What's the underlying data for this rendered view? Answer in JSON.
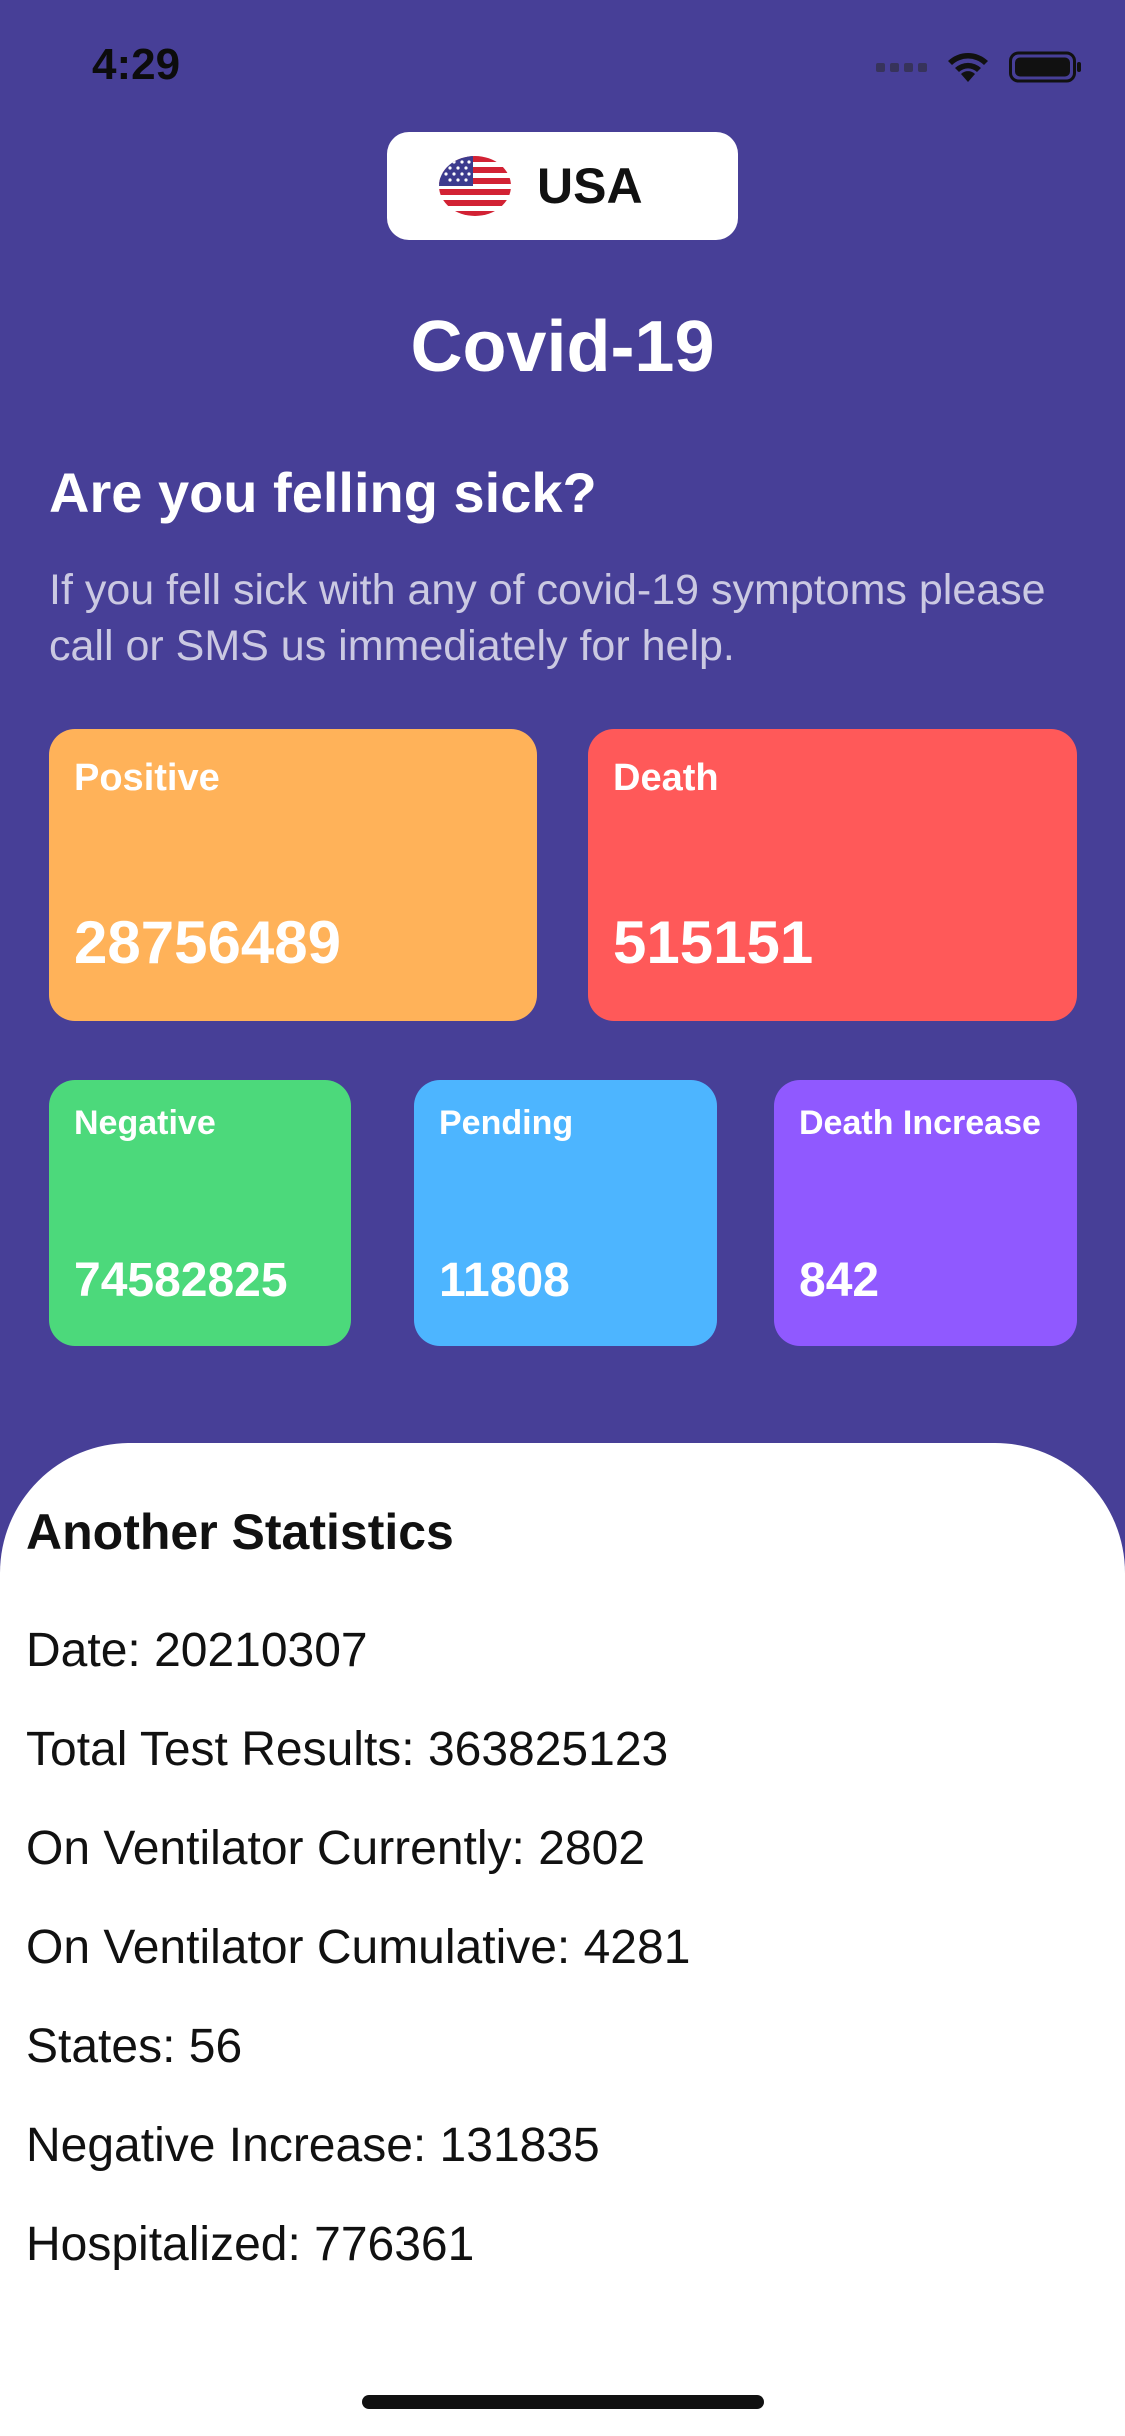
{
  "status_bar": {
    "time": "4:29"
  },
  "country": {
    "name": "USA",
    "flag_icon": "us-flag-icon"
  },
  "title": "Covid-19",
  "sick": {
    "heading": "Are you felling sick?",
    "description": "If you fell sick with any of covid-19 symptoms please call or SMS us immediately for help."
  },
  "cards": {
    "positive": {
      "label": "Positive",
      "value": "28756489",
      "color": "#ffb259"
    },
    "death": {
      "label": "Death",
      "value": "515151",
      "color": "#ff5959"
    },
    "negative": {
      "label": "Negative",
      "value": "74582825",
      "color": "#4cd97b"
    },
    "pending": {
      "label": "Pending",
      "value": "11808",
      "color": "#4db5ff"
    },
    "death_increase": {
      "label": "Death Increase",
      "value": "842",
      "color": "#9059ff"
    }
  },
  "stats": {
    "title": "Another Statistics",
    "lines": [
      "Date: 20210307",
      "Total Test Results: 363825123",
      "On Ventilator Currently: 2802",
      "On Ventilator Cumulative: 4281",
      "States: 56",
      "Negative Increase: 131835",
      "Hospitalized: 776361"
    ]
  }
}
